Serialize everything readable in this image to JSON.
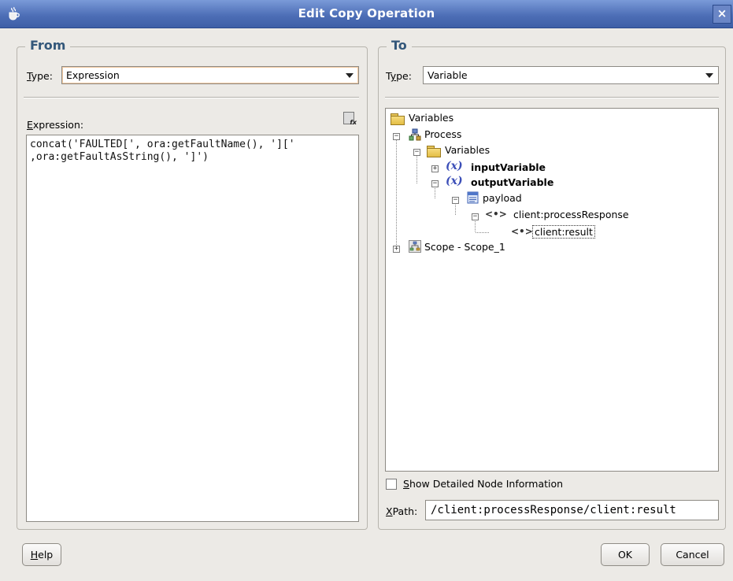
{
  "window": {
    "title": "Edit Copy Operation",
    "close_glyph": "×"
  },
  "from": {
    "group_title": "From",
    "type_label": "Type:",
    "type_value": "Expression",
    "expression_label": "Expression:",
    "expression_lines": [
      "concat('FAULTED[', ora:getFaultName(), '][' ",
      ",ora:getFaultAsString(), ']')"
    ]
  },
  "to": {
    "group_title": "To",
    "type_label": "Type:",
    "type_value": "Variable",
    "tree": {
      "root": "Variables",
      "process": "Process",
      "variables": "Variables",
      "var_glyph": "(x)",
      "input_variable": "inputVariable",
      "output_variable": "outputVariable",
      "payload": "payload",
      "element_glyph": "<•>",
      "process_response": "client:processResponse",
      "result": "client:result",
      "scope": "Scope - Scope_1"
    },
    "show_detailed_label": "Show Detailed Node Information",
    "xpath_label": "XPath:",
    "xpath_value": "/client:processResponse/client:result"
  },
  "buttons": {
    "help": "Help",
    "ok": "OK",
    "cancel": "Cancel"
  }
}
